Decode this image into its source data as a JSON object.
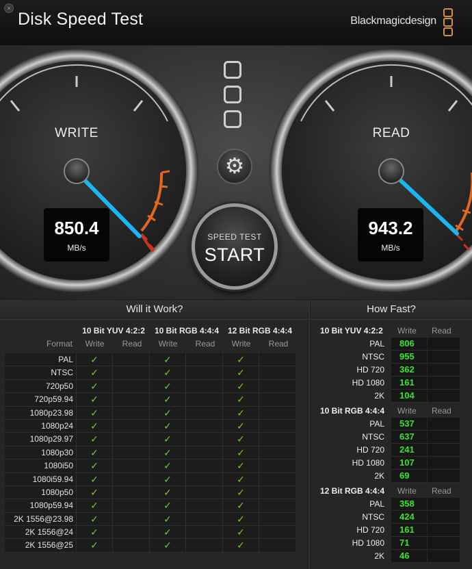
{
  "window": {
    "title": "Disk Speed Test",
    "brand": "Blackmagicdesign",
    "close_glyph": "×"
  },
  "gauges": {
    "write": {
      "label": "WRITE",
      "value": "850.4",
      "unit": "MB/s"
    },
    "read": {
      "label": "READ",
      "value": "943.2",
      "unit": "MB/s"
    }
  },
  "start_button": {
    "top_label": "SPEED TEST",
    "label": "START"
  },
  "settings_icon": "gear-icon",
  "colors": {
    "check": "#6fd12a",
    "speed_value": "#39e52a",
    "brand_logo": "#d8913a",
    "needle": "#19b6f2",
    "redline": "#d0321a",
    "orange": "#e2681e"
  },
  "will_it_work": {
    "title": "Will it Work?",
    "format_header": "Format",
    "groups": [
      {
        "name": "10 Bit YUV 4:2:2",
        "write": "Write",
        "read": "Read"
      },
      {
        "name": "10 Bit RGB 4:4:4",
        "write": "Write",
        "read": "Read"
      },
      {
        "name": "12 Bit RGB 4:4:4",
        "write": "Write",
        "read": "Read"
      }
    ],
    "check_glyph": "✓",
    "rows": [
      {
        "format": "PAL",
        "checks": [
          true,
          false,
          true,
          false,
          true,
          false
        ]
      },
      {
        "format": "NTSC",
        "checks": [
          true,
          false,
          true,
          false,
          true,
          false
        ]
      },
      {
        "format": "720p50",
        "checks": [
          true,
          false,
          true,
          false,
          true,
          false
        ]
      },
      {
        "format": "720p59.94",
        "checks": [
          true,
          false,
          true,
          false,
          true,
          false
        ]
      },
      {
        "format": "1080p23.98",
        "checks": [
          true,
          false,
          true,
          false,
          true,
          false
        ]
      },
      {
        "format": "1080p24",
        "checks": [
          true,
          false,
          true,
          false,
          true,
          false
        ]
      },
      {
        "format": "1080p29.97",
        "checks": [
          true,
          false,
          true,
          false,
          true,
          false
        ]
      },
      {
        "format": "1080p30",
        "checks": [
          true,
          false,
          true,
          false,
          true,
          false
        ]
      },
      {
        "format": "1080i50",
        "checks": [
          true,
          false,
          true,
          false,
          true,
          false
        ]
      },
      {
        "format": "1080i59.94",
        "checks": [
          true,
          false,
          true,
          false,
          true,
          false
        ]
      },
      {
        "format": "1080p50",
        "checks": [
          true,
          false,
          true,
          false,
          true,
          false
        ]
      },
      {
        "format": "1080p59.94",
        "checks": [
          true,
          false,
          true,
          false,
          true,
          false
        ]
      },
      {
        "format": "2K 1556@23.98",
        "checks": [
          true,
          false,
          true,
          false,
          true,
          false
        ]
      },
      {
        "format": "2K 1556@24",
        "checks": [
          true,
          false,
          true,
          false,
          true,
          false
        ]
      },
      {
        "format": "2K 1556@25",
        "checks": [
          true,
          false,
          true,
          false,
          true,
          false
        ]
      }
    ]
  },
  "how_fast": {
    "title": "How Fast?",
    "sections": [
      {
        "name": "10 Bit YUV 4:2:2",
        "write": "Write",
        "read": "Read",
        "rows": [
          {
            "label": "PAL",
            "write": "806"
          },
          {
            "label": "NTSC",
            "write": "955"
          },
          {
            "label": "HD 720",
            "write": "362"
          },
          {
            "label": "HD 1080",
            "write": "161"
          },
          {
            "label": "2K",
            "write": "104"
          }
        ]
      },
      {
        "name": "10 Bit RGB 4:4:4",
        "write": "Write",
        "read": "Read",
        "rows": [
          {
            "label": "PAL",
            "write": "537"
          },
          {
            "label": "NTSC",
            "write": "637"
          },
          {
            "label": "HD 720",
            "write": "241"
          },
          {
            "label": "HD 1080",
            "write": "107"
          },
          {
            "label": "2K",
            "write": "69"
          }
        ]
      },
      {
        "name": "12 Bit RGB 4:4:4",
        "write": "Write",
        "read": "Read",
        "rows": [
          {
            "label": "PAL",
            "write": "358"
          },
          {
            "label": "NTSC",
            "write": "424"
          },
          {
            "label": "HD 720",
            "write": "161"
          },
          {
            "label": "HD 1080",
            "write": "71"
          },
          {
            "label": "2K",
            "write": "46"
          }
        ]
      }
    ]
  }
}
